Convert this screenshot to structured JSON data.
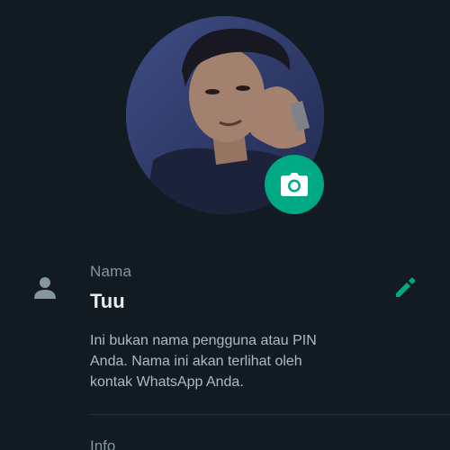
{
  "profile": {
    "photo": {
      "description": "profile-photo",
      "camera_icon": "camera-icon",
      "accent_color": "#00a884"
    },
    "name_section": {
      "icon": "person-icon",
      "label": "Nama",
      "value": "Tuu",
      "edit_icon": "pencil-icon",
      "hint_lines": [
        "Ini bukan nama pengguna atau PIN",
        "Anda. Nama ini akan terlihat oleh",
        "kontak WhatsApp Anda."
      ]
    },
    "next_section": {
      "label": "Info"
    }
  },
  "colors": {
    "background": "#121b22",
    "primary_text": "#e9edef",
    "secondary_text": "#8696a0",
    "accent": "#00a884"
  }
}
